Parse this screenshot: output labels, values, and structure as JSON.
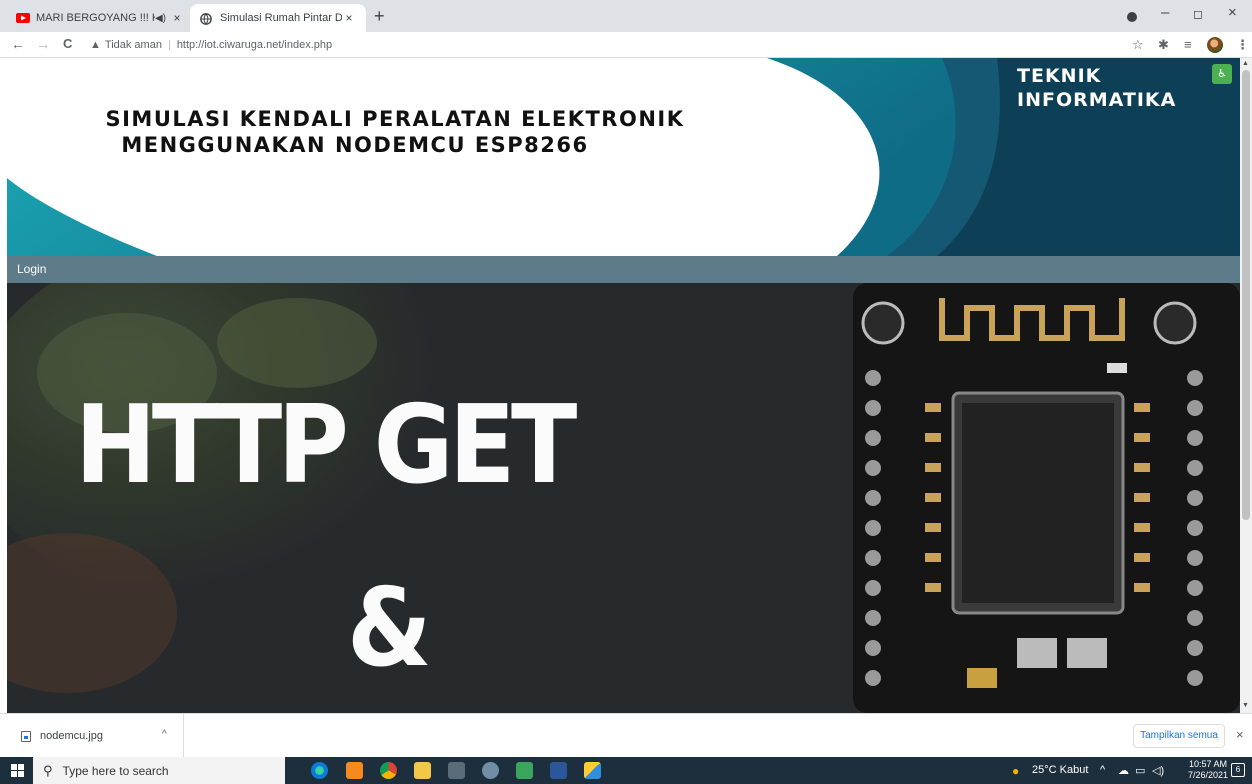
{
  "browser": {
    "tabs": [
      {
        "title": "MARI BERGOYANG !!! KOMP"
      },
      {
        "title": "Simulasi Rumah Pintar Dengan M"
      }
    ],
    "new_tab": "+",
    "close_glyph": "×",
    "nav": {
      "back": "←",
      "forward": "→",
      "reload": "C"
    },
    "security_label": "Tidak aman",
    "url": "http://iot.ciwaruga.net/index.php",
    "window_controls": {
      "minimize": "–",
      "maximize": "◻",
      "close": "×"
    }
  },
  "page": {
    "title_line1": "SIMULASI KENDALI PERALATAN ELEKTRONIK",
    "title_line2": "MENGGUNAKAN NODEMCU ESP8266",
    "brand_line1": "TEKNIK",
    "brand_line2": "INFORMATIKA",
    "menu": {
      "login": "Login"
    },
    "hero": {
      "line1": "HTTP GET",
      "line2": "&"
    }
  },
  "downloads": {
    "file_name": "nodemcu.jpg",
    "show_all": "Tampilkan semua",
    "close": "×"
  },
  "taskbar": {
    "search_placeholder": "Type here to search",
    "weather": "25°C  Kabut",
    "time": "10:57 AM",
    "date": "7/26/2021",
    "notification_count": "6"
  },
  "colors": {
    "header_dark": "#0d3f57",
    "header_teal": "#1aa7b4",
    "menubar": "#5d7b88",
    "hero_bg": "#262a2c",
    "taskbar": "#1d2f3c"
  }
}
